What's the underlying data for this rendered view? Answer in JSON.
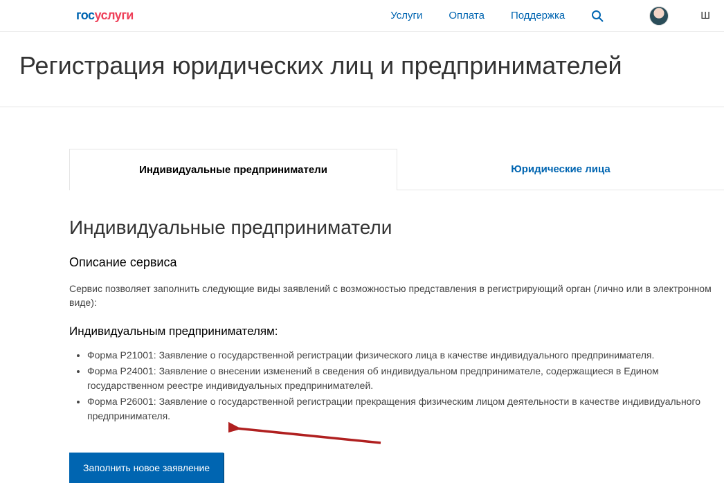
{
  "header": {
    "logo_blue": "гос",
    "logo_red": "услуги",
    "nav": {
      "services": "Услуги",
      "payment": "Оплата",
      "support": "Поддержка"
    },
    "user_initial": "Ш"
  },
  "page_title": "Регистрация юридических лиц и предпринимателей",
  "tabs": {
    "individual": "Индивидуальные предприниматели",
    "legal": "Юридические лица"
  },
  "main": {
    "section_title": "Индивидуальные предприниматели",
    "subsection_title": "Описание сервиса",
    "description": "Сервис позволяет заполнить следующие виды заявлений с возможностью представления в регистрирующий орган (лично или в электронном виде):",
    "forms_heading": "Индивидуальным предпринимателям:",
    "forms": [
      "Форма Р21001: Заявление о государственной регистрации физического лица в качестве индивидуального предпринимателя.",
      "Форма Р24001: Заявление о внесении изменений в сведения об индивидуальном предпринимателе, содержащиеся в Едином государственном реестре индивидуальных предпринимателей.",
      "Форма Р26001: Заявление о государственной регистрации прекращения физическим лицом деятельности в качестве индивидуального предпринимателя."
    ],
    "cta_label": "Заполнить новое заявление"
  }
}
